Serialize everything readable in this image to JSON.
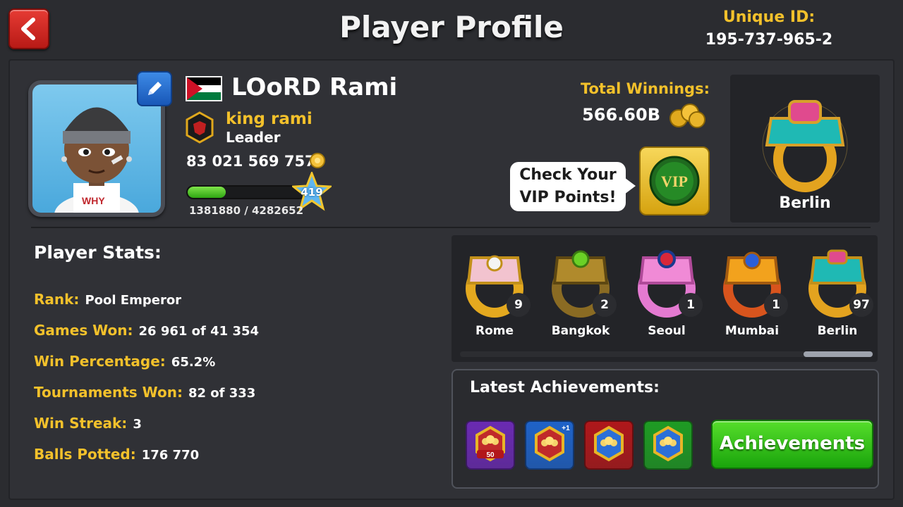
{
  "header": {
    "title": "Player Profile",
    "unique_id_label": "Unique ID:",
    "unique_id_value": "195-737-965-2"
  },
  "player": {
    "name": "LOoRD Rami",
    "club_name": "king rami",
    "club_role": "Leader",
    "coins": "83 021 569 757",
    "xp_text": "1381880 / 4282652",
    "xp_fraction": 0.323,
    "level": "419"
  },
  "winnings": {
    "label": "Total Winnings:",
    "value": "566.60B"
  },
  "vip": {
    "bubble_line1": "Check Your",
    "bubble_line2": "VIP Points!",
    "badge_text": "VIP"
  },
  "featured_ring": {
    "name": "Berlin"
  },
  "stats": {
    "title": "Player Stats:",
    "rows": [
      {
        "label": "Rank:",
        "value": "Pool Emperor"
      },
      {
        "label": "Games Won:",
        "value": "26 961 of 41 354"
      },
      {
        "label": "Win Percentage:",
        "value": "65.2%"
      },
      {
        "label": "Tournaments Won:",
        "value": "82 of 333"
      },
      {
        "label": "Win Streak:",
        "value": "3"
      },
      {
        "label": "Balls Potted:",
        "value": "176 770"
      }
    ]
  },
  "rings": [
    {
      "name": "Rome",
      "count": "9"
    },
    {
      "name": "Bangkok",
      "count": "2"
    },
    {
      "name": "Seoul",
      "count": "1"
    },
    {
      "name": "Mumbai",
      "count": "1"
    },
    {
      "name": "Berlin",
      "count": "97"
    }
  ],
  "achievements": {
    "title": "Latest Achievements:",
    "button_label": "Achievements",
    "badges": [
      {
        "color": "#6b2bb3",
        "label": "50"
      },
      {
        "color": "#1f63c9",
        "label": "+1"
      },
      {
        "color": "#b0181b",
        "label": ""
      },
      {
        "color": "#1f9c24",
        "label": ""
      }
    ]
  },
  "colors": {
    "accent_gold": "#f3c12b",
    "background": "#2b2c30",
    "back_button": "#d9302a",
    "achievements_button": "#2cc016"
  }
}
